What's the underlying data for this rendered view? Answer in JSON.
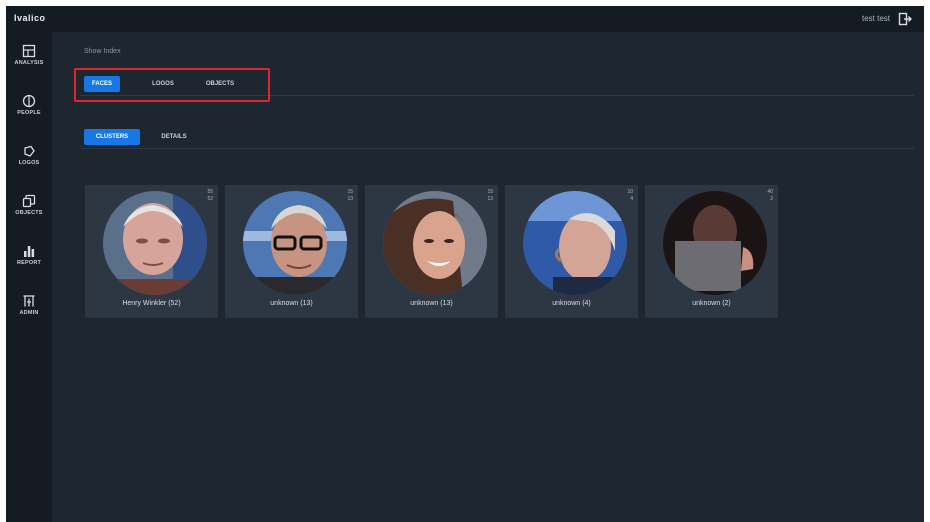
{
  "app": {
    "logo": "Ivalico",
    "user": "test test"
  },
  "sidebar": {
    "items": [
      {
        "label": "ANALYSIS",
        "icon": "analysis-icon"
      },
      {
        "label": "PEOPLE",
        "icon": "people-icon"
      },
      {
        "label": "LOGOS",
        "icon": "logos-icon"
      },
      {
        "label": "OBJECTS",
        "icon": "objects-icon"
      },
      {
        "label": "REPORT",
        "icon": "report-icon"
      },
      {
        "label": "ADMIN",
        "icon": "admin-icon"
      }
    ]
  },
  "main": {
    "breadcrumb": "Show Index",
    "tabs": [
      {
        "label": "FACES",
        "active": true
      },
      {
        "label": "LOGOS",
        "active": false
      },
      {
        "label": "OBJECTS",
        "active": false
      }
    ],
    "subtabs": [
      {
        "label": "CLUSTERS",
        "active": true
      },
      {
        "label": "DETAILS",
        "active": false
      }
    ],
    "clusters": [
      {
        "name": "Henry Winkler (52)",
        "count_top": "55",
        "count_bottom": "52"
      },
      {
        "name": "unknown (13)",
        "count_top": "15",
        "count_bottom": "13"
      },
      {
        "name": "unknown (13)",
        "count_top": "15",
        "count_bottom": "13"
      },
      {
        "name": "unknown (4)",
        "count_top": "10",
        "count_bottom": "4"
      },
      {
        "name": "unknown (2)",
        "count_top": "40",
        "count_bottom": "2"
      }
    ]
  },
  "colors": {
    "accent": "#1677e5",
    "highlight": "#e0262a",
    "background": "#1e2630",
    "sidebar": "#151b22",
    "card": "#2d3743"
  }
}
